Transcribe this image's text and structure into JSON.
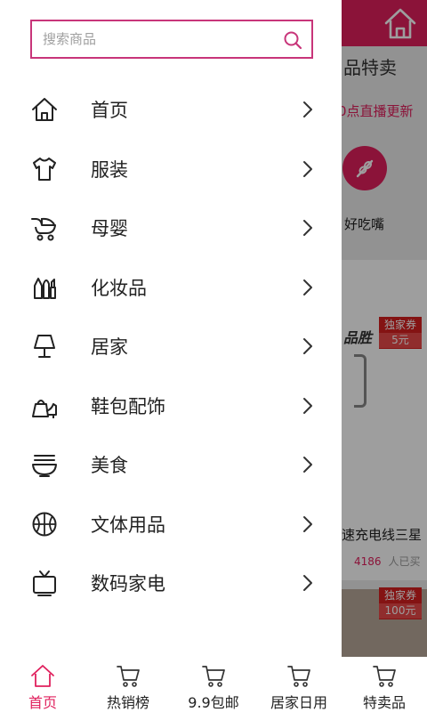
{
  "colors": {
    "accent": "#e0205d",
    "search_border": "#c8357a",
    "scrim": "rgba(0,0,0,0.38)"
  },
  "background_page": {
    "section_title": "品特卖",
    "live_text": "0点直播更新",
    "category_label": "好吃嘴",
    "category_icon": "food-skewer-icon",
    "brand_text": "品胜",
    "coupons": [
      {
        "label": "独家券",
        "value": "5元"
      },
      {
        "label": "独家券",
        "value": "100元"
      }
    ],
    "product_title": "速充电线三星",
    "sold_count": "4186",
    "sold_suffix": "人已买",
    "home_icon": "home-icon"
  },
  "drawer": {
    "search": {
      "placeholder": "搜索商品",
      "value": "",
      "icon": "search-icon"
    },
    "menu": [
      {
        "label": "首页",
        "icon": "home-icon"
      },
      {
        "label": "服装",
        "icon": "tshirt-icon"
      },
      {
        "label": "母婴",
        "icon": "stroller-icon"
      },
      {
        "label": "化妆品",
        "icon": "cosmetics-icon"
      },
      {
        "label": "居家",
        "icon": "lamp-icon"
      },
      {
        "label": "鞋包配饰",
        "icon": "bag-shoe-icon"
      },
      {
        "label": "美食",
        "icon": "noodle-bowl-icon"
      },
      {
        "label": "文体用品",
        "icon": "ball-icon"
      },
      {
        "label": "数码家电",
        "icon": "tv-icon"
      }
    ]
  },
  "tabbar": {
    "tabs": [
      {
        "label": "首页",
        "icon": "home-icon",
        "active": true
      },
      {
        "label": "热销榜",
        "icon": "cart-icon"
      },
      {
        "label": "9.9包邮",
        "icon": "cart-icon"
      },
      {
        "label": "居家日用",
        "icon": "cart-icon"
      },
      {
        "label": "特卖品",
        "icon": "cart-icon"
      }
    ]
  }
}
